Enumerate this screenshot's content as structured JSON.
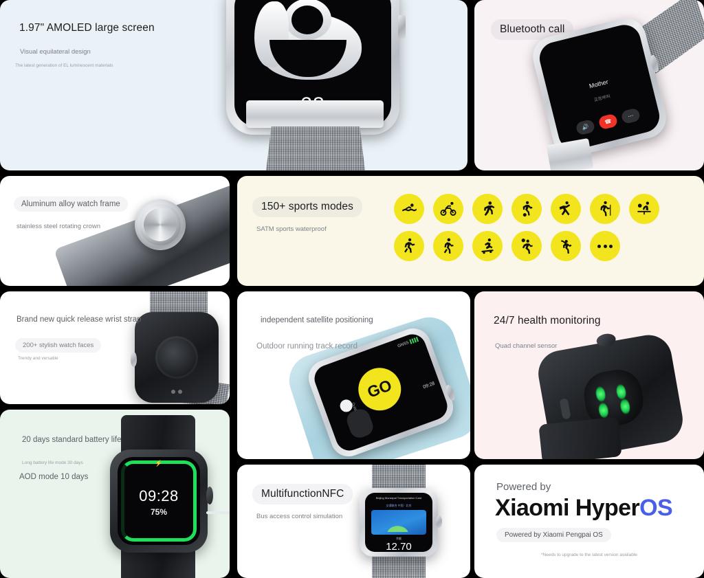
{
  "panels": {
    "amoled": {
      "headline": "1.97\" AMOLED large screen",
      "sub1": "Visual equilateral design",
      "sub2": "The latest generation of EL luminescent materials",
      "watch_date": "28",
      "bg": "#eaf2f8"
    },
    "bluetooth": {
      "headline": "Bluetooth call",
      "caller": "Mother",
      "caller_sub": "正在呼叫",
      "buttons": [
        "mute",
        "hangup",
        "more"
      ],
      "bg": "#f9f2f5"
    },
    "frame": {
      "headline": "Aluminum alloy watch frame",
      "sub1": "stainless steel rotating crown",
      "bg": "#ffffff"
    },
    "sports": {
      "headline": "150+ sports modes",
      "sub1": "SATM sports waterproof",
      "bg": "#faf7e8",
      "icon_color": "#f2e41d",
      "icons": [
        [
          "swimming-icon",
          "cycling-icon",
          "running-icon",
          "soccer-icon",
          "dancing-icon",
          "hiking-icon",
          "table-tennis-icon"
        ],
        [
          "climbing-icon",
          "walking-icon",
          "skateboarding-icon",
          "basketball-icon",
          "golf-icon",
          "more-icon"
        ]
      ]
    },
    "strap": {
      "headline": "Brand new quick release wrist strap",
      "sub1": "200+ stylish watch faces",
      "sub2": "Trendy and versatile",
      "bg": "#ffffff"
    },
    "gps": {
      "headline": "independent satellite positioning",
      "sub1": "Outdoor running track record",
      "watch_go": "GO",
      "watch_gnss": "GNSS",
      "watch_time": "09:28",
      "watch_mode": "Outdoor running",
      "bg": "#ffffff"
    },
    "health": {
      "headline": "24/7 health monitoring",
      "sub1": "Quad channel sensor",
      "bg": "#fdf0f0"
    },
    "battery": {
      "headline": "20 days standard battery life",
      "sub1": "Long battery life mode 30 days",
      "sub2": "AOD mode 10 days",
      "watch_time": "09:28",
      "watch_pct": "75%",
      "ring_color": "#1ee05a",
      "bg": "#e8f4ec"
    },
    "nfc": {
      "headline": "MultifunctionNFC",
      "sub1": "Bus access control simulation",
      "card_title": "Beijing Municipal Transportation Card",
      "card_sub": "交通联合 中国 · 北京",
      "balance_label": "余额",
      "balance": "12.70",
      "bg": "#ffffff"
    },
    "hyperos": {
      "powered": "Powered by",
      "brand_main": "Xiaomi Hyper",
      "brand_accent": "OS",
      "accent_color": "#4a5fe8",
      "note": "Powered by Xiaomi Pengpai OS",
      "footnote": "*Needs to upgrade to the latest version available",
      "bg": "#ffffff"
    }
  }
}
